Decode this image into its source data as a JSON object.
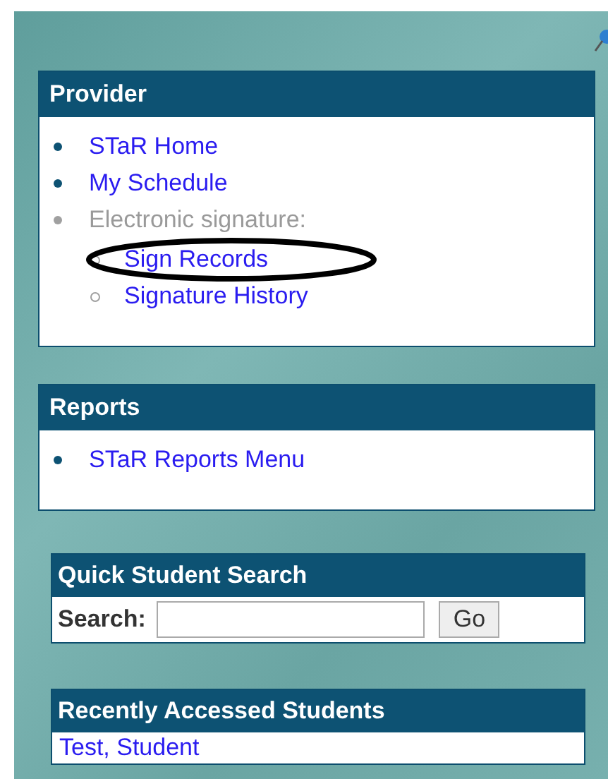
{
  "panels": [
    {
      "kind": "menu",
      "title": "Provider",
      "items": [
        {
          "label": "STaR Home",
          "disabled": false
        },
        {
          "label": "My Schedule",
          "disabled": false
        },
        {
          "label": "Electronic signature:",
          "disabled": true,
          "children": [
            {
              "label": "Sign Records",
              "disabled": false,
              "circled": true
            },
            {
              "label": "Signature History",
              "disabled": false,
              "circled": false
            }
          ]
        }
      ]
    },
    {
      "kind": "menu",
      "title": "Reports",
      "items": [
        {
          "label": "STaR Reports Menu",
          "disabled": false
        }
      ]
    },
    {
      "kind": "search",
      "title": "Quick Student Search",
      "label": "Search:",
      "button": "Go"
    },
    {
      "kind": "links",
      "title": "Recently Accessed Students",
      "links": [
        "Test, Student"
      ]
    }
  ]
}
